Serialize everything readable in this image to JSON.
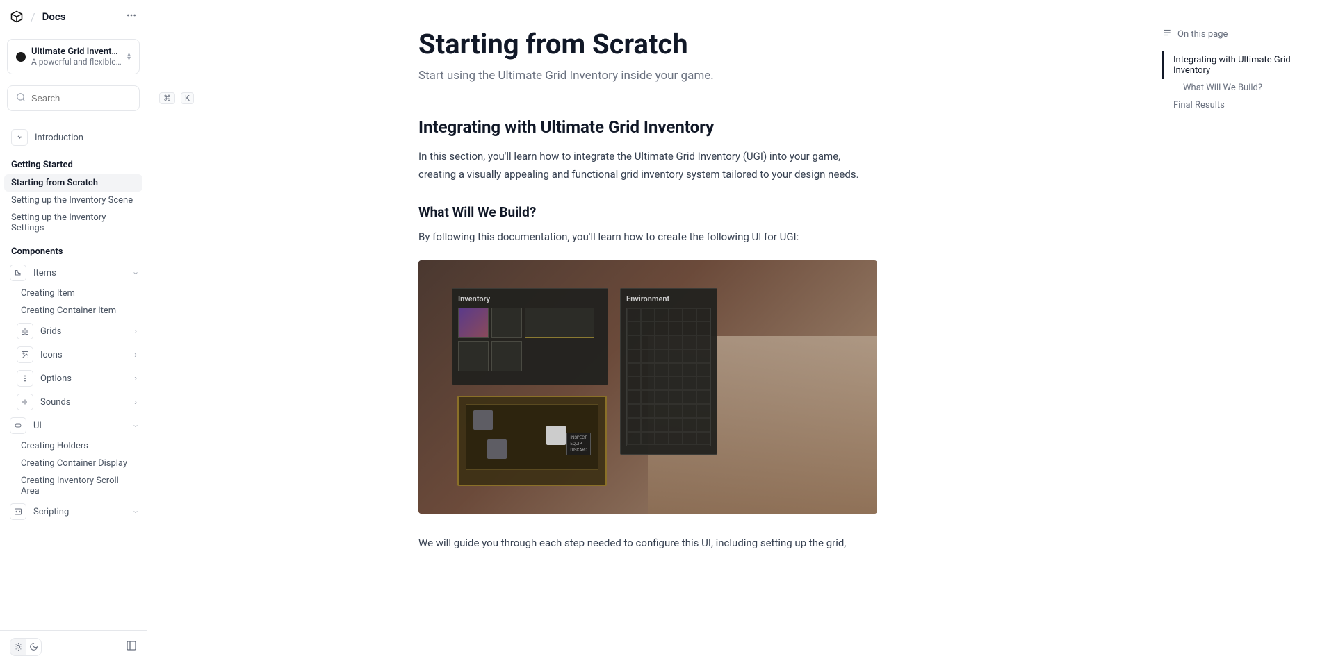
{
  "header": {
    "title": "Docs"
  },
  "product": {
    "name": "Ultimate Grid Inventory",
    "description": "A powerful and flexible ..."
  },
  "search": {
    "placeholder": "Search",
    "shortcut_cmd": "⌘",
    "shortcut_key": "K"
  },
  "nav": {
    "intro": "Introduction",
    "section_getting_started": "Getting Started",
    "starting_from_scratch": "Starting from Scratch",
    "setting_up_scene": "Setting up the Inventory Scene",
    "setting_up_settings": "Setting up the Inventory Settings",
    "section_components": "Components",
    "items": "Items",
    "creating_item": "Creating Item",
    "creating_container_item": "Creating Container Item",
    "grids": "Grids",
    "icons": "Icons",
    "options": "Options",
    "sounds": "Sounds",
    "ui": "UI",
    "creating_holders": "Creating Holders",
    "creating_container_display": "Creating Container Display",
    "creating_inventory_scroll": "Creating Inventory Scroll Area",
    "scripting": "Scripting"
  },
  "content": {
    "title": "Starting from Scratch",
    "subtitle": "Start using the Ultimate Grid Inventory inside your game.",
    "h2_1": "Integrating with Ultimate Grid Inventory",
    "p1": "In this section, you'll learn how to integrate the Ultimate Grid Inventory (UGI) into your game, creating a visually appealing and functional grid inventory system tailored to your design needs.",
    "h3_1": "What Will We Build?",
    "p2": "By following this documentation, you'll learn how to create the following UI for UGI:",
    "p3": "We will guide you through each step needed to configure this UI, including setting up the grid,",
    "screenshot": {
      "panel_inventory": "Inventory",
      "panel_environment": "Environment",
      "menu_inspect": "INSPECT",
      "menu_equip": "EQUIP",
      "menu_discard": "DISCARD"
    }
  },
  "toc": {
    "label": "On this page",
    "item1": "Integrating with Ultimate Grid Inventory",
    "item2": "What Will We Build?",
    "item3": "Final Results"
  }
}
